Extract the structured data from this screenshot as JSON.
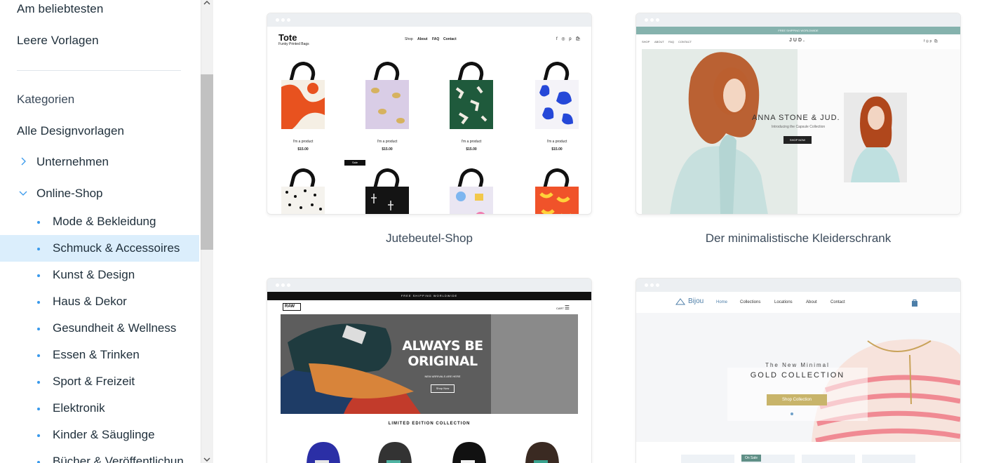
{
  "sidebar": {
    "top_links": [
      "Am beliebtesten",
      "Leere Vorlagen"
    ],
    "heading": "Kategorien",
    "all_templates": "Alle Designvorlagen",
    "categories": [
      {
        "label": "Unternehmen",
        "state": "collapsed"
      },
      {
        "label": "Online-Shop",
        "state": "expanded"
      }
    ],
    "subcategories": [
      {
        "label": "Mode & Bekleidung"
      },
      {
        "label": "Schmuck & Accessoires",
        "selected": true
      },
      {
        "label": "Kunst & Design"
      },
      {
        "label": "Haus & Dekor"
      },
      {
        "label": "Gesundheit & Wellness"
      },
      {
        "label": "Essen & Trinken"
      },
      {
        "label": "Sport & Freizeit"
      },
      {
        "label": "Elektronik"
      },
      {
        "label": "Kinder & Säuglinge"
      },
      {
        "label": "Bücher & Veröffentlichun"
      }
    ]
  },
  "colors": {
    "accent": "#3899ec",
    "selected_bg": "#dbeefc",
    "text": "#20303c"
  },
  "templates": [
    {
      "title": "Jutebeutel-Shop",
      "preview": {
        "logo": "Tote",
        "tagline": "Funky Printed Bags",
        "menu": [
          "Shop",
          "About",
          "FAQ",
          "Contact"
        ],
        "icons": "f ◎ p 🛍",
        "product_name": "I'm a product",
        "product_price": "$15.00",
        "sale_label": "Sale"
      }
    },
    {
      "title": "Der minimalistische Kleiderschrank",
      "preview": {
        "banner": "FREE SHIPPING WORLDWIDE",
        "menu": [
          "SHOP",
          "ABOUT",
          "FAQ",
          "CONTACT"
        ],
        "logo": "JUD.",
        "headline": "ANNA STONE & JUD.",
        "subline": "Introducing the Capsule Collection",
        "button": "SHOP NOW"
      }
    },
    {
      "title": "",
      "preview": {
        "banner": "FREE SHIPPING WORLDWIDE",
        "logo": "RAW",
        "cart": "CART",
        "headline": "ALWAYS BE ORIGINAL",
        "subline": "NEW ARRIVALS ARE HERE",
        "button": "Shop Now",
        "section": "LIMITED EDITION COLLECTION"
      }
    },
    {
      "title": "",
      "preview": {
        "logo": "Bijou",
        "menu": [
          "Home",
          "Collections",
          "Locations",
          "About",
          "Contact"
        ],
        "small_heading": "The New Minimal",
        "big_heading": "GOLD COLLECTION",
        "button": "Shop Collection",
        "sale_label": "On Sale"
      }
    }
  ]
}
